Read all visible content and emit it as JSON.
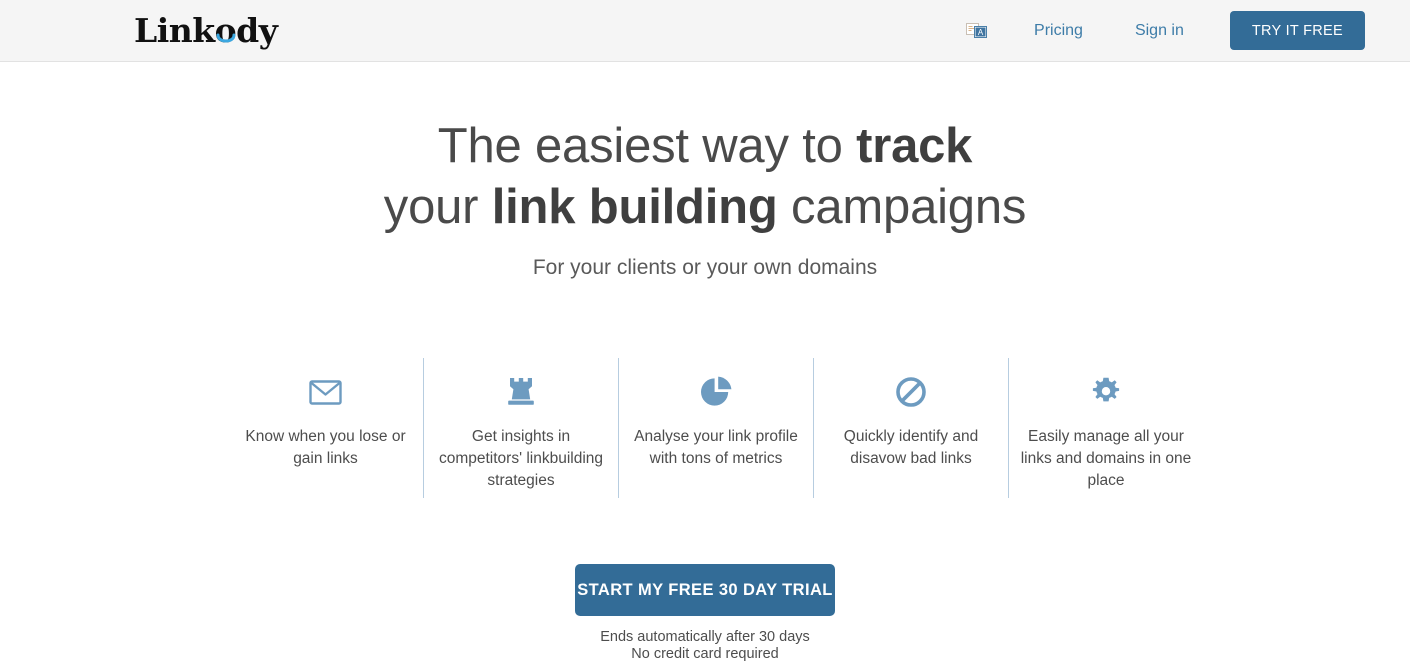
{
  "header": {
    "brand": {
      "text_before": "Link",
      "text_o": "o",
      "text_after": "dy",
      "accent_color": "#3ba7e0"
    },
    "lang_icon": "language-flags-icon",
    "nav": {
      "pricing": "Pricing",
      "sign_in": "Sign in",
      "try_it_free": "TRY IT FREE"
    },
    "background_color": "#f5f5f5",
    "accent_color": "#336c97",
    "link_color": "#3d7ca8"
  },
  "hero": {
    "heading_line1_a": "The easiest way to ",
    "heading_line1_b": "track",
    "heading_line2_a": "your ",
    "heading_line2_b": "link building",
    "heading_line2_c": " campaigns",
    "subheading": "For your clients or your own domains",
    "heading_color": "#4a4a4a"
  },
  "features": [
    {
      "icon": "envelope-icon",
      "text": "Know when you lose or gain links"
    },
    {
      "icon": "chess-rook-icon",
      "text": "Get insights in competitors' linkbuilding strategies"
    },
    {
      "icon": "pie-chart-icon",
      "text": "Analyse your link profile with tons of metrics"
    },
    {
      "icon": "ban-icon",
      "text": "Quickly identify and disavow bad links"
    },
    {
      "icon": "gear-icon",
      "text": "Easily manage all your links and domains in one place"
    }
  ],
  "features_meta": {
    "icon_color": "#6d9bc0",
    "divider_color": "#b7cde0"
  },
  "cta": {
    "button_label": "START MY FREE 30 DAY TRIAL",
    "note_line1": "Ends automatically after 30 days",
    "note_line2": "No credit card required",
    "button_color": "#336c97"
  }
}
